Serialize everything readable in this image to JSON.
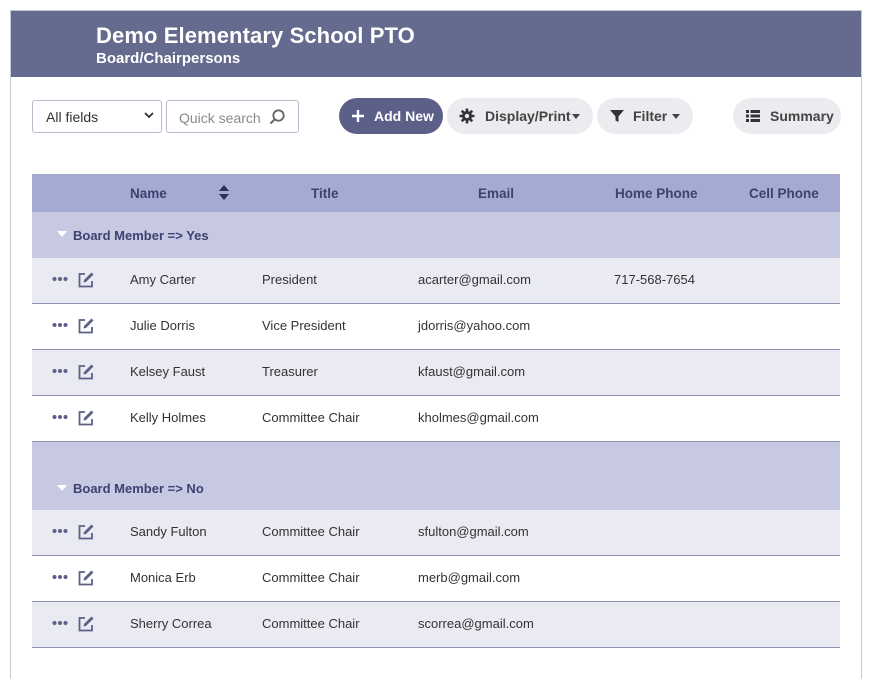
{
  "header": {
    "title": "Demo Elementary School PTO",
    "subtitle": "Board/Chairpersons"
  },
  "toolbar": {
    "field_select": "All fields",
    "search_placeholder": "Quick search",
    "add_new": "Add New",
    "display_print": "Display/Print",
    "filter": "Filter",
    "summary": "Summary"
  },
  "columns": [
    "Name",
    "Title",
    "Email",
    "Home Phone",
    "Cell Phone"
  ],
  "groups": [
    {
      "label": "Board Member => Yes",
      "rows": [
        {
          "name": "Amy Carter",
          "title": "President",
          "email": "acarter@gmail.com",
          "home_phone": "717-568-7654",
          "cell_phone": ""
        },
        {
          "name": "Julie Dorris",
          "title": "Vice President",
          "email": "jdorris@yahoo.com",
          "home_phone": "",
          "cell_phone": ""
        },
        {
          "name": "Kelsey Faust",
          "title": "Treasurer",
          "email": "kfaust@gmail.com",
          "home_phone": "",
          "cell_phone": ""
        },
        {
          "name": "Kelly Holmes",
          "title": "Committee Chair",
          "email": "kholmes@gmail.com",
          "home_phone": "",
          "cell_phone": ""
        }
      ]
    },
    {
      "label": "Board Member => No",
      "rows": [
        {
          "name": "Sandy Fulton",
          "title": "Committee Chair",
          "email": "sfulton@gmail.com",
          "home_phone": "",
          "cell_phone": ""
        },
        {
          "name": "Monica Erb",
          "title": "Committee Chair",
          "email": "merb@gmail.com",
          "home_phone": "",
          "cell_phone": ""
        },
        {
          "name": "Sherry Correa",
          "title": "Committee Chair",
          "email": "scorrea@gmail.com",
          "home_phone": "",
          "cell_phone": ""
        }
      ]
    }
  ],
  "colors": {
    "header_bg": "#656a8f",
    "table_header_bg": "#a5aad3",
    "group_bg": "#c7c9e2",
    "accent": "#5c6088"
  }
}
